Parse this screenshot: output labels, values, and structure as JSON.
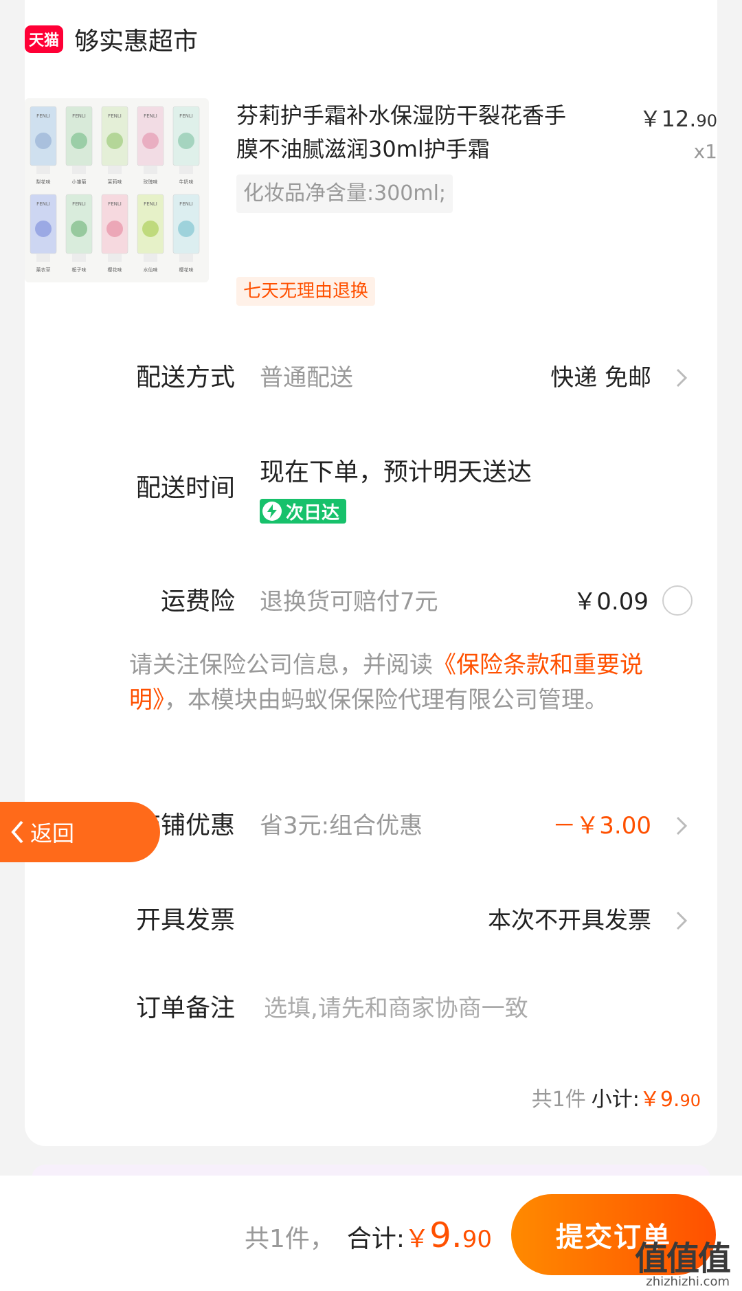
{
  "store": {
    "badge": "天猫",
    "name": "够实惠超市"
  },
  "product": {
    "title": "芬莉护手霜补水保湿防干裂花香手膜不油腻滋润30ml护手霜",
    "price_main": "￥12.",
    "price_decimal": "90",
    "quantity": "x1",
    "sku": "化妆品净含量:300ml;",
    "return_tag": "七天无理由退换",
    "image_tubes_brand": "FENLI",
    "image_flavors": [
      "梨花味",
      "小雏菊",
      "茉莉味",
      "玫瑰味",
      "牛奶味",
      "薰衣草",
      "栀子味",
      "樱花味",
      "水仙味",
      "樱花味"
    ]
  },
  "delivery": {
    "label": "配送方式",
    "desc": "普通配送",
    "value": "快递 免邮"
  },
  "delivery_time": {
    "label": "配送时间",
    "main": "现在下单，预计明天送达",
    "badge": "次日达"
  },
  "insurance": {
    "label": "运费险",
    "desc": "退换货可赔付7元",
    "value": "￥0.09"
  },
  "notice": {
    "prefix": "请关注保险公司信息，并阅读",
    "link": "《保险条款和重要说明》",
    "suffix": "，本模块由蚂蚁保保险代理有限公司管理。"
  },
  "back": {
    "label": "返回"
  },
  "discount": {
    "label": "店铺优惠",
    "desc": "省3元:组合优惠",
    "value": "－￥3.00"
  },
  "invoice": {
    "label": "开具发票",
    "value": "本次不开具发票"
  },
  "remark": {
    "label": "订单备注",
    "placeholder": "选填,请先和商家协商一致"
  },
  "subtotal": {
    "count": "共1件",
    "label": "小计:",
    "amount_main": "￥9.",
    "amount_decimal": "90"
  },
  "footer": {
    "count": "共1件，",
    "label": "合计:",
    "currency": "￥",
    "amount_int": "9.",
    "amount_decimal": "90",
    "submit": "提交订单"
  },
  "watermark": {
    "logo": "值值值",
    "url": "zhizhizhi.com"
  },
  "colors": {
    "accent": "#ff5000",
    "tmall": "#ff0036",
    "green_badge": "#17c16b",
    "back_button": "#ff6a1a"
  }
}
